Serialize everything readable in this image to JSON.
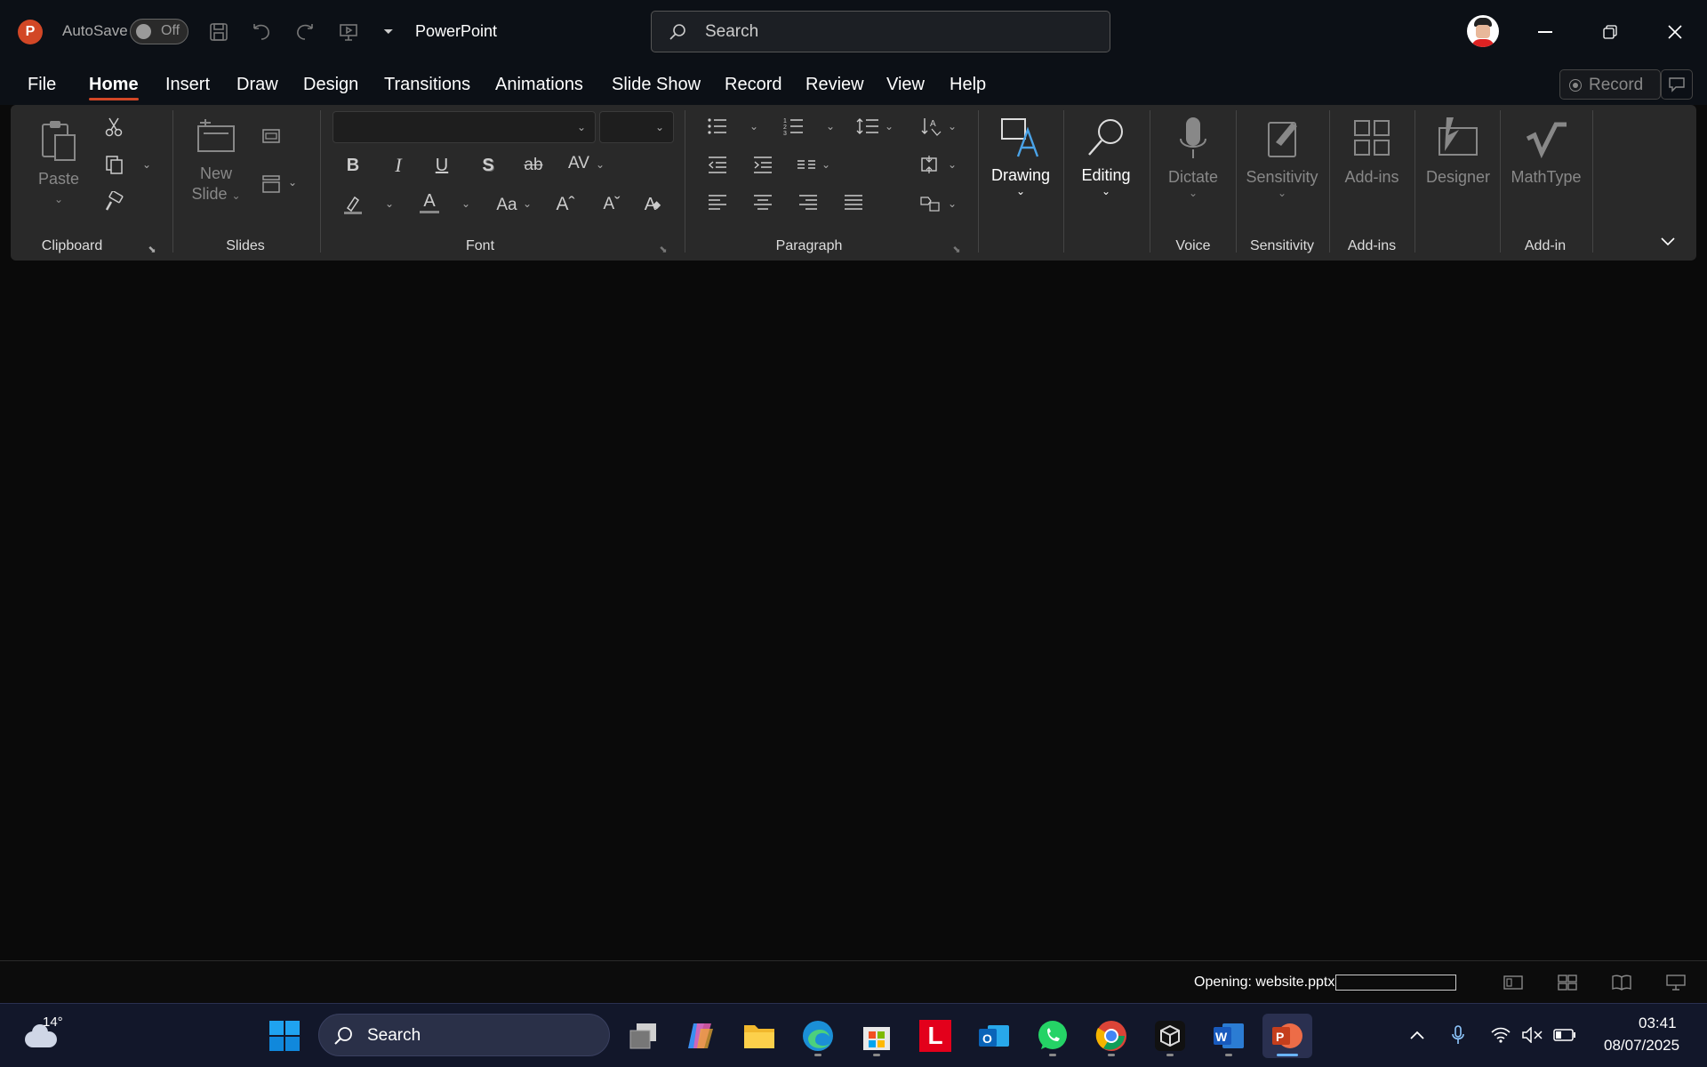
{
  "titlebar": {
    "autosave_label": "AutoSave",
    "autosave_state": "Off",
    "app_title": "PowerPoint",
    "search_placeholder": "Search"
  },
  "tabs": [
    "File",
    "Home",
    "Insert",
    "Draw",
    "Design",
    "Transitions",
    "Animations",
    "Slide Show",
    "Record",
    "Review",
    "View",
    "Help"
  ],
  "active_tab": "Home",
  "record_button": "Record",
  "ribbon": {
    "clipboard": {
      "paste": "Paste",
      "label": "Clipboard"
    },
    "slides": {
      "new_slide_1": "New",
      "new_slide_2": "Slide",
      "label": "Slides"
    },
    "font": {
      "label": "Font",
      "aa": "Aa"
    },
    "paragraph": {
      "label": "Paragraph"
    },
    "drawing": "Drawing",
    "editing": "Editing",
    "voice": {
      "dictate": "Dictate",
      "label": "Voice"
    },
    "sensitivity": {
      "button": "Sensitivity",
      "label": "Sensitivity"
    },
    "addins": {
      "button": "Add-ins",
      "label": "Add-ins"
    },
    "designer": "Designer",
    "mathtype": {
      "button": "MathType",
      "label": "Add-in"
    }
  },
  "status": {
    "opening_text": "Opening: website.pptx",
    "progress": 0
  },
  "taskbar": {
    "weather_temp": "14°",
    "search_placeholder": "Search",
    "time": "03:41",
    "date": "08/07/2025"
  },
  "colors": {
    "accent": "#d24726",
    "ribbon_bg": "#292929",
    "titlebar_bg": "#0c1016",
    "taskbar_bg": "#12172a"
  }
}
